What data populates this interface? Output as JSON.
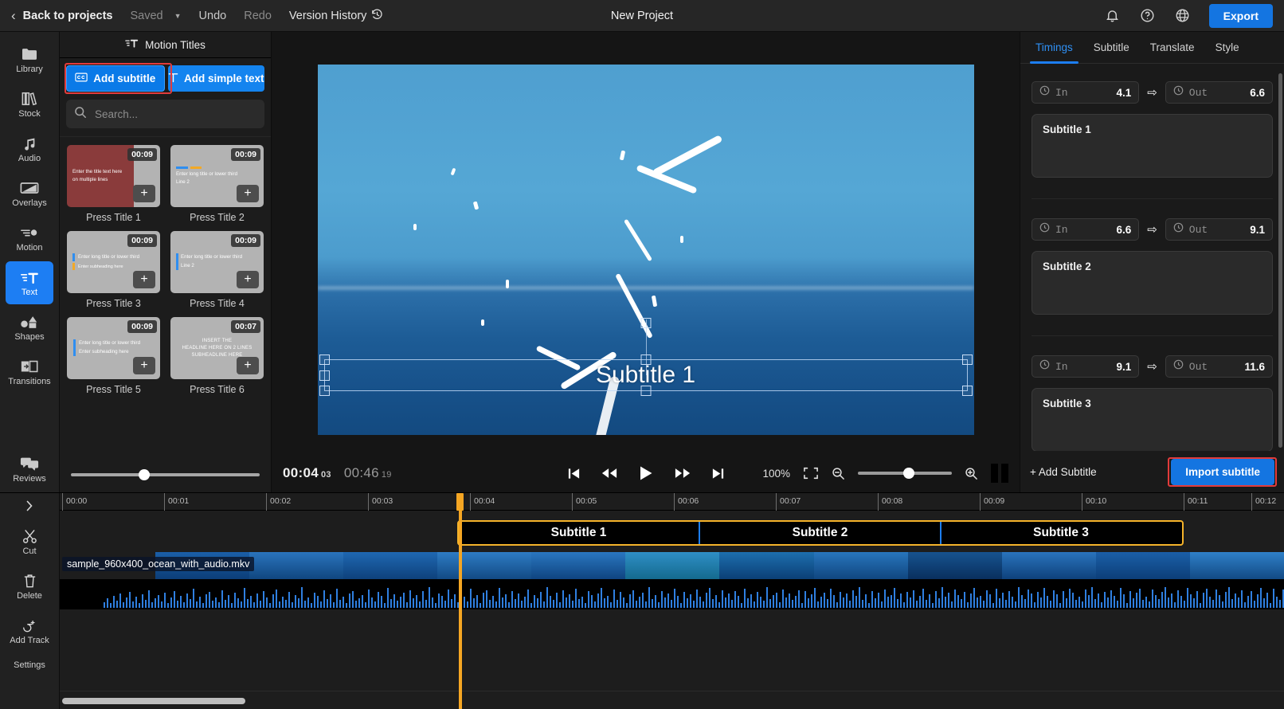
{
  "topbar": {
    "back_label": "Back to projects",
    "saved_label": "Saved",
    "undo_label": "Undo",
    "redo_label": "Redo",
    "version_history_label": "Version History",
    "project_title": "New Project",
    "export_label": "Export"
  },
  "rail": {
    "items": [
      {
        "label": "Library",
        "icon": "folder-icon"
      },
      {
        "label": "Stock",
        "icon": "books-icon"
      },
      {
        "label": "Audio",
        "icon": "music-note-icon"
      },
      {
        "label": "Overlays",
        "icon": "overlay-icon"
      },
      {
        "label": "Motion",
        "icon": "motion-icon"
      },
      {
        "label": "Text",
        "icon": "text-icon"
      },
      {
        "label": "Shapes",
        "icon": "shapes-icon"
      },
      {
        "label": "Transitions",
        "icon": "transitions-icon"
      },
      {
        "label": "Reviews",
        "icon": "comments-icon"
      }
    ],
    "active": "Text",
    "timeline_tools": [
      {
        "label": "Cut",
        "icon": "scissors-icon"
      },
      {
        "label": "Delete",
        "icon": "trash-icon"
      },
      {
        "label": "Add Track",
        "icon": "add-track-icon"
      },
      {
        "label": "Settings",
        "icon": "settings-icon"
      }
    ]
  },
  "panel": {
    "title": "Motion Titles",
    "add_subtitle_label": "Add subtitle",
    "add_simple_text_label": "Add simple text",
    "search_placeholder": "Search...",
    "search_value": "",
    "templates": [
      {
        "label": "Press Title 1",
        "duration": "00:09",
        "line1": "Enter the title text here",
        "line2": "on multiple lines"
      },
      {
        "label": "Press Title 2",
        "duration": "00:09",
        "line1": "Enter long title or lower third",
        "line2": "Line 2"
      },
      {
        "label": "Press Title 3",
        "duration": "00:09",
        "line1": "Enter long title or lower third",
        "line2": "Enter subheading here"
      },
      {
        "label": "Press Title 4",
        "duration": "00:09",
        "line1": "Enter long title or lower third",
        "line2": "Line 2"
      },
      {
        "label": "Press Title 5",
        "duration": "00:09",
        "line1": "Enter long title or lower third",
        "line2": "Enter subheading here"
      },
      {
        "label": "Press Title 6",
        "duration": "00:07",
        "line1": "INSERT THE",
        "line2": "HEADLINE HERE ON 2 LINES",
        "line3": "SUBHEADLINE HERE"
      }
    ]
  },
  "preview": {
    "subtitle_overlay_text": "Subtitle 1",
    "current_time": "00:04",
    "current_frame": "03",
    "total_time": "00:46",
    "total_frame": "19",
    "zoom_level": "100%"
  },
  "inspector": {
    "tabs": [
      {
        "label": "Timings"
      },
      {
        "label": "Subtitle"
      },
      {
        "label": "Translate"
      },
      {
        "label": "Style"
      }
    ],
    "active_tab": "Timings",
    "in_label": "In",
    "out_label": "Out",
    "subtitles": [
      {
        "in": "4.1",
        "out": "6.6",
        "text": "Subtitle 1"
      },
      {
        "in": "6.6",
        "out": "9.1",
        "text": "Subtitle 2"
      },
      {
        "in": "9.1",
        "out": "11.6",
        "text": "Subtitle 3"
      }
    ],
    "add_subtitle_label": "+ Add Subtitle",
    "import_subtitle_label": "Import subtitle"
  },
  "timeline": {
    "ruler_ticks": [
      "00:00",
      "00:01",
      "00:02",
      "00:03",
      "00:04",
      "00:05",
      "00:06",
      "00:07",
      "00:08",
      "00:09",
      "00:10",
      "00:11",
      "00:12"
    ],
    "playhead_time": "00:04",
    "subtitle_clips": [
      {
        "label": "Subtitle 1"
      },
      {
        "label": "Subtitle 2"
      },
      {
        "label": "Subtitle 3"
      }
    ],
    "video_clip_name": "sample_960x400_ocean_with_audio.mkv"
  },
  "colors": {
    "accent_blue": "#1d7ef3",
    "highlight_red": "#e23b3b",
    "playhead_orange": "#f5a623",
    "clip_border_yellow": "#f5b32a",
    "waveform_blue": "#2f7fe0"
  }
}
